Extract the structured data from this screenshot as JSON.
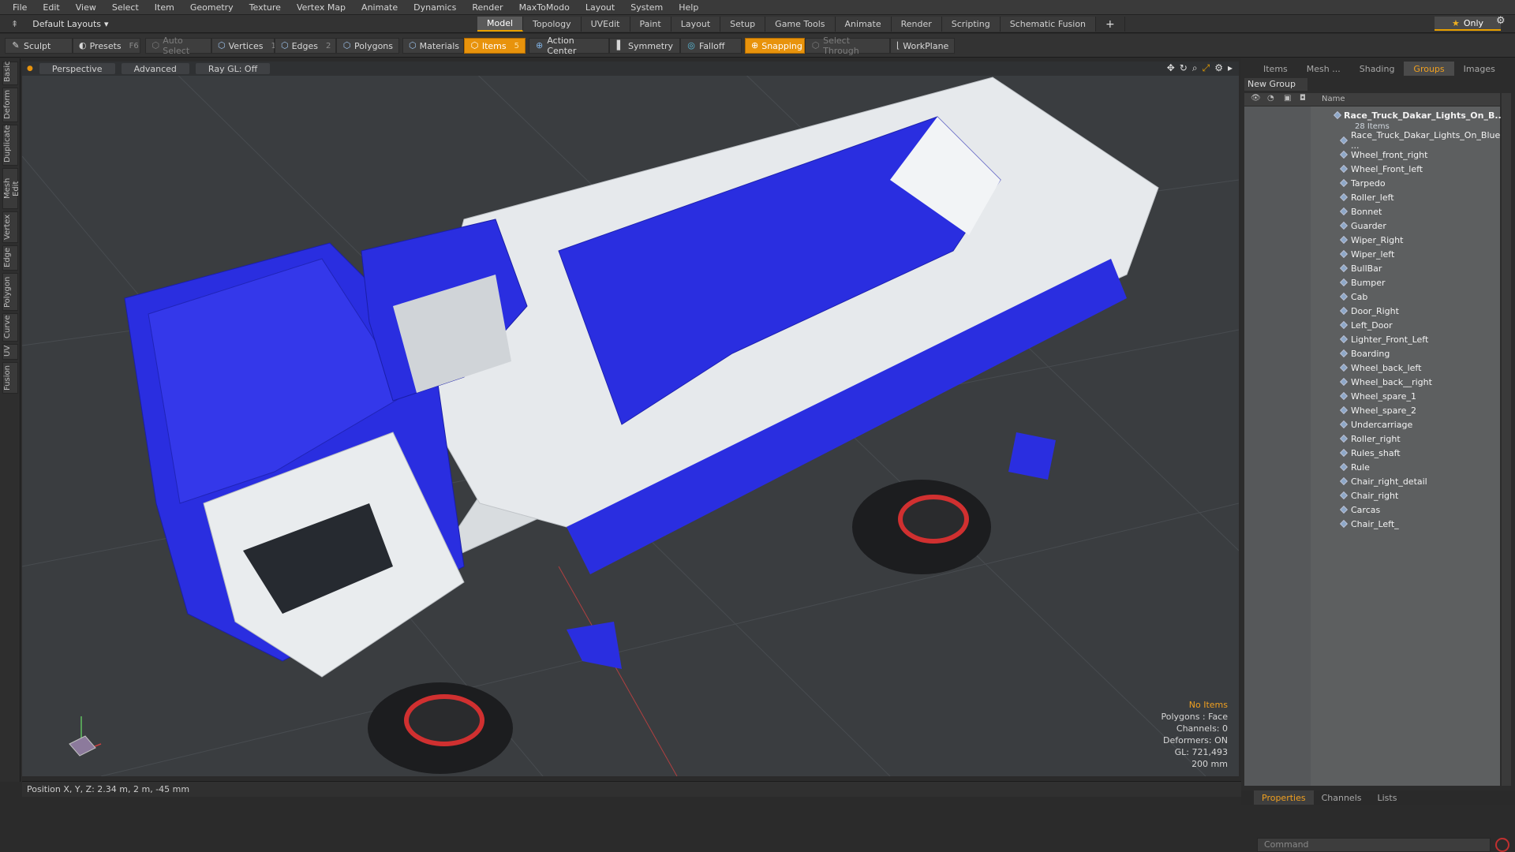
{
  "menu": [
    "File",
    "Edit",
    "View",
    "Select",
    "Item",
    "Geometry",
    "Texture",
    "Vertex Map",
    "Animate",
    "Dynamics",
    "Render",
    "MaxToModo",
    "Layout",
    "System",
    "Help"
  ],
  "layout_select": "Default Layouts",
  "tabs": [
    "Model",
    "Topology",
    "UVEdit",
    "Paint",
    "Layout",
    "Setup",
    "Game Tools",
    "Animate",
    "Render",
    "Scripting",
    "Schematic Fusion"
  ],
  "active_tab": "Model",
  "only_label": "Only",
  "toolbar": {
    "sculpt": "Sculpt",
    "presets": "Presets",
    "presets_key": "F6",
    "auto_select": "Auto Select",
    "vertices": "Vertices",
    "vertices_key": "1",
    "edges": "Edges",
    "edges_key": "2",
    "polygons": "Polygons",
    "materials": "Materials",
    "items": "Items",
    "items_key": "5",
    "action_center": "Action Center",
    "symmetry": "Symmetry",
    "falloff": "Falloff",
    "snapping": "Snapping",
    "select_through": "Select Through",
    "workplane": "WorkPlane"
  },
  "left_tabs": [
    "Basic",
    "Deform",
    "Duplicate",
    "Mesh Edit",
    "Vertex",
    "Edge",
    "Polygon",
    "Curve",
    "UV",
    "Fusion"
  ],
  "viewport": {
    "perspective": "Perspective",
    "advanced": "Advanced",
    "raygl": "Ray GL: Off",
    "info": {
      "no_items": "No Items",
      "polygons": "Polygons : Face",
      "channels": "Channels: 0",
      "deformers": "Deformers: ON",
      "gl": "GL: 721,493",
      "scale": "200 mm"
    }
  },
  "status": "Position X, Y, Z:   2.34 m, 2 m, -45 mm",
  "right_tabs": [
    "Items",
    "Mesh ...",
    "Shading",
    "Groups",
    "Images"
  ],
  "active_right_tab": "Groups",
  "new_group": "New Group",
  "list_header": "Name",
  "root": {
    "name": "Race_Truck_Dakar_Lights_On_B...",
    "count": "28 Items"
  },
  "items": [
    "Race_Truck_Dakar_Lights_On_Blue ...",
    "Wheel_front_right",
    "Wheel_Front_left",
    "Tarpedo",
    "Roller_left",
    "Bonnet",
    "Guarder",
    "Wiper_Right",
    "Wiper_left",
    "BullBar",
    "Bumper",
    "Cab",
    "Door_Right",
    "Left_Door",
    "Lighter_Front_Left",
    "Boarding",
    "Wheel_back_left",
    "Wheel_back__right",
    "Wheel_spare_1",
    "Wheel_spare_2",
    "Undercarriage",
    "Roller_right",
    "Rules_shaft",
    "Rule",
    "Chair_right_detail",
    "Chair_right",
    "Carcas",
    "Chair_Left_"
  ],
  "bottom_tabs": [
    "Properties",
    "Channels",
    "Lists"
  ],
  "command_placeholder": "Command",
  "colors": {
    "accent": "#e8930c",
    "truck_blue": "#2a2ee0",
    "viewport_bg": "#3a3d40"
  }
}
